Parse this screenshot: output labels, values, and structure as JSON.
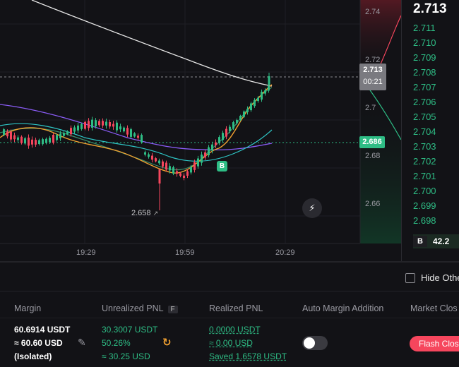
{
  "chart": {
    "price_axis": [
      "2.74",
      "2.72",
      "2.7",
      "2.68",
      "2.66"
    ],
    "time_axis": [
      "19:29",
      "19:59",
      "20:29"
    ],
    "current_price": "2.713",
    "countdown": "00:21",
    "mark_price": "2.686",
    "low_label": "2.658",
    "buy_marker": "B",
    "colors": {
      "up": "#2ebd85",
      "down": "#f6465d",
      "ma_orange": "#f0a030",
      "ma_teal": "#2ec4c4",
      "ma_purple": "#8a5cf6",
      "ma_white": "#e8e8e8"
    }
  },
  "orderbook": {
    "last_price": "2.713",
    "levels": [
      "2.711",
      "2.710",
      "2.709",
      "2.708",
      "2.707",
      "2.706",
      "2.705",
      "2.704",
      "2.703",
      "2.702",
      "2.701",
      "2.700",
      "2.699",
      "2.698"
    ],
    "bottom_badge": "B",
    "bottom_value": "42.2"
  },
  "panel": {
    "hide_other_label": "Hide Othe",
    "headers": {
      "margin": "Margin",
      "unrealized_pnl": "Unrealized PNL",
      "unrealized_badge": "F",
      "realized_pnl": "Realized PNL",
      "auto_margin": "Auto Margin Addition",
      "market_close": "Market Clos"
    },
    "margin": {
      "usdt": "60.6914 USDT",
      "usd": "≈ 60.60 USD",
      "mode": "(Isolated)"
    },
    "unrealized": {
      "usdt": "30.3007 USDT",
      "percent": "50.26%",
      "usd": "≈ 30.25 USD"
    },
    "realized": {
      "usdt": "0.0000 USDT",
      "usd": "≈ 0.00 USD",
      "saved": "Saved 1.6578 USDT"
    },
    "flash_close_label": "Flash Clos"
  }
}
